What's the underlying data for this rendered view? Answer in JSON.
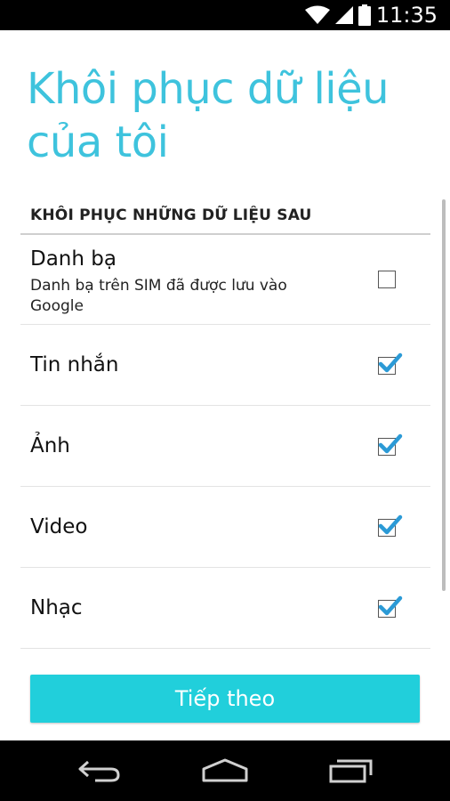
{
  "status_bar": {
    "time": "11:35",
    "icons": [
      "wifi-icon",
      "signal-icon",
      "battery-icon"
    ]
  },
  "page": {
    "title_line1": "Khôi phục dữ liệu",
    "title_line2": "của tôi",
    "title_color": "#3ec3dd"
  },
  "section": {
    "header": "KHÔI PHỤC NHỮNG DỮ LIỆU SAU"
  },
  "options": [
    {
      "label": "Danh bạ",
      "subtitle": "Danh bạ trên SIM đã được lưu vào Google",
      "checked": false
    },
    {
      "label": "Tin nhắn",
      "checked": true
    },
    {
      "label": "Ảnh",
      "checked": true
    },
    {
      "label": "Video",
      "checked": true
    },
    {
      "label": "Nhạc",
      "checked": true
    }
  ],
  "next_button": {
    "label": "Tiếp theo",
    "color": "#21cfdb"
  },
  "nav_bar": {
    "icons": [
      "back-icon",
      "home-icon",
      "recent-apps-icon"
    ]
  }
}
